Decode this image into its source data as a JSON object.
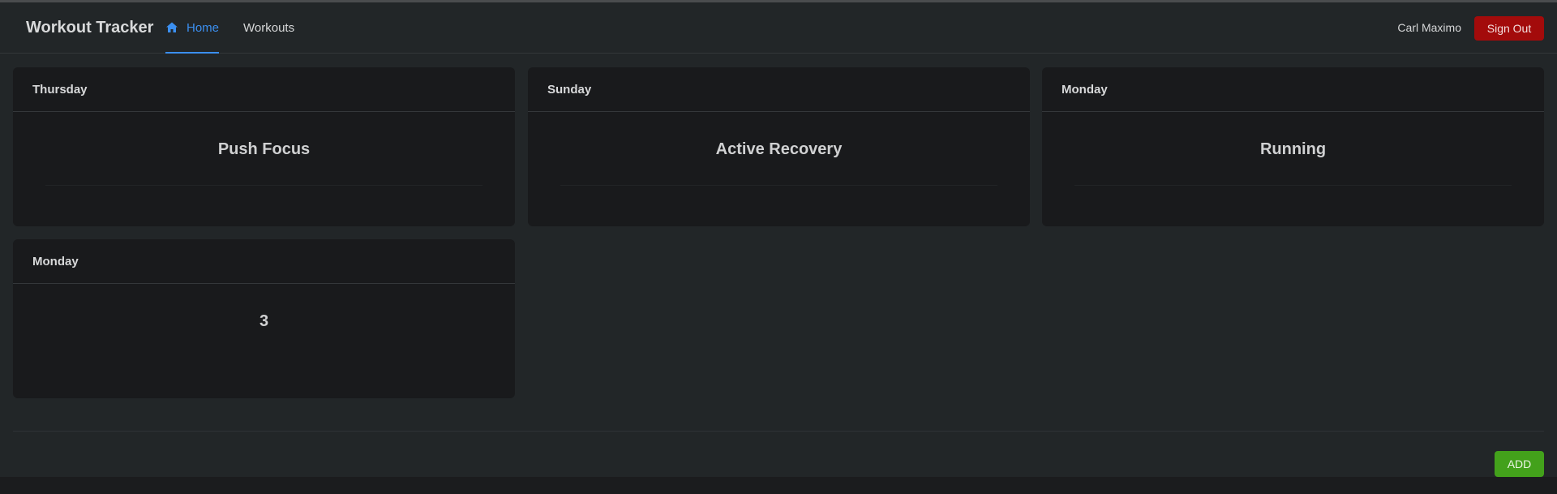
{
  "navbar": {
    "brand": "Workout Tracker",
    "links": [
      {
        "label": "Home",
        "icon": "home-icon",
        "active": true
      },
      {
        "label": "Workouts",
        "active": false
      }
    ],
    "user_name": "Carl Maximo",
    "signout_label": "Sign Out"
  },
  "cards": [
    {
      "day": "Thursday",
      "workout": "Push Focus"
    },
    {
      "day": "Sunday",
      "workout": "Active Recovery"
    },
    {
      "day": "Monday",
      "workout": "Running"
    },
    {
      "day": "Monday",
      "workout": "3"
    }
  ],
  "footer": {
    "add_label": "ADD"
  },
  "colors": {
    "background": "#222628",
    "card": "#191a1c",
    "accent": "#3b8ff0",
    "danger": "#a30b0b",
    "success": "#43a11b"
  }
}
